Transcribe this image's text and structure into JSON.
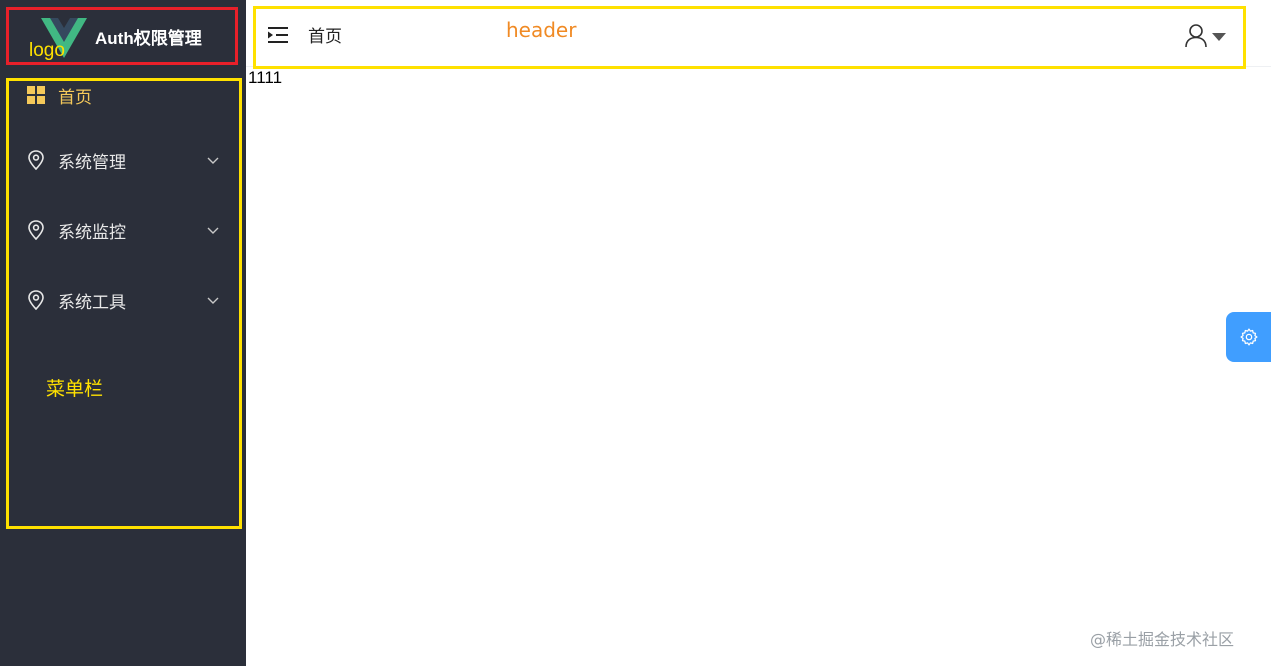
{
  "app": {
    "logo_text": "logo",
    "title": "Auth权限管理"
  },
  "sidebar": {
    "items": [
      {
        "label": "首页",
        "icon": "grid-icon",
        "active": true
      },
      {
        "label": "系统管理",
        "icon": "location-pin-icon",
        "expandable": true
      },
      {
        "label": "系统监控",
        "icon": "location-pin-icon",
        "expandable": true
      },
      {
        "label": "系统工具",
        "icon": "location-pin-icon",
        "expandable": true
      }
    ],
    "caption": "菜单栏"
  },
  "header": {
    "breadcrumb": "首页",
    "caption": "header",
    "toggle_icon": "menu-fold-icon",
    "user_icon": "user-icon",
    "dropdown_icon": "caret-down-icon"
  },
  "content": {
    "text": "1111"
  },
  "settings": {
    "icon": "gear-icon"
  },
  "watermark": "@稀土掘金技术社区",
  "colors": {
    "sidebar_bg": "#2b2f3a",
    "active_menu": "#f5c95a",
    "annotation_yellow": "#ffe100",
    "annotation_red": "#e8202a",
    "header_caption": "#f08a24",
    "settings_button": "#409eff"
  }
}
